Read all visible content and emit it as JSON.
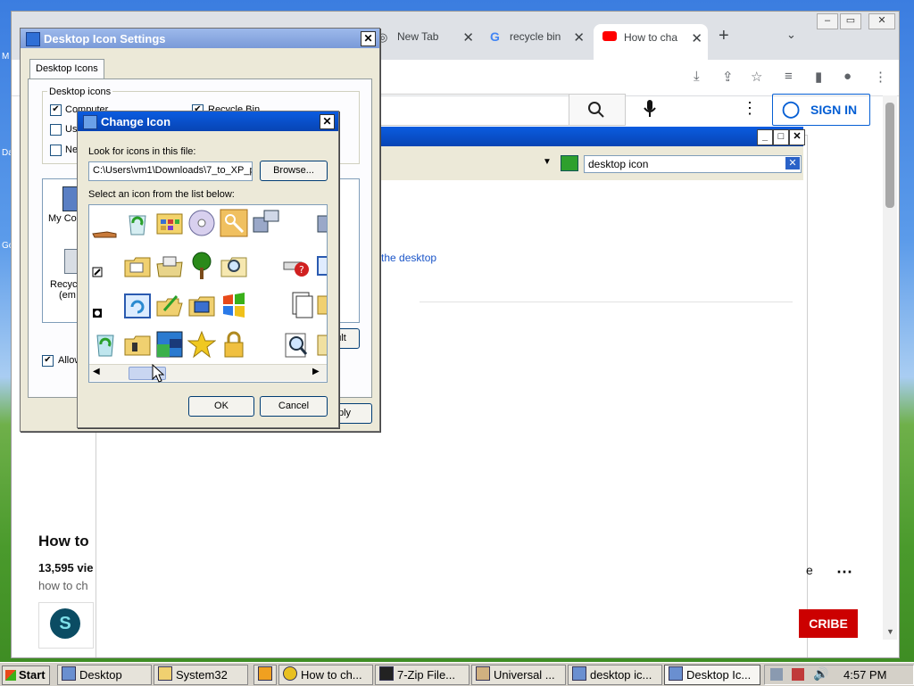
{
  "desktop": {
    "labels": [
      "M",
      "Da",
      "Go"
    ]
  },
  "chrome": {
    "tabs": [
      {
        "label": "New Tab",
        "close": "✕"
      },
      {
        "label": "recycle bin",
        "close": "✕"
      },
      {
        "label": "How to cha",
        "close": "✕"
      }
    ],
    "new_tab": "+",
    "window_controls": [
      "‒",
      "▭",
      "✕"
    ],
    "youtube": {
      "sign_in": "SIGN IN",
      "video_title": "How to",
      "views": "13,595 vie",
      "description": "how to ch",
      "subscribe": "CRIBE",
      "more": "e",
      "channel_letter": "S"
    }
  },
  "zip_window": {
    "search_value": "desktop icon",
    "result_link": "the desktop",
    "default_button": "ault",
    "apply_button": "ply"
  },
  "desktop_icon_settings": {
    "title": "Desktop Icon Settings",
    "tab": "Desktop Icons",
    "group": "Desktop icons",
    "checkboxes": [
      {
        "label": "Computer",
        "checked": true
      },
      {
        "label": "Recycle Bin",
        "checked": true
      },
      {
        "label": "Us",
        "checked": false
      },
      {
        "label": "Ne",
        "checked": false
      }
    ],
    "icons": [
      "My Co",
      "Recyc",
      "(em"
    ],
    "allow_label": "Allow",
    "allow_checked": true
  },
  "change_icon": {
    "title": "Change Icon",
    "look_label": "Look for icons in this file:",
    "path_value": "C:\\Users\\vm1\\Downloads\\7_to_XP_p",
    "browse": "Browse...",
    "select_label": "Select an icon from the list below:",
    "ok": "OK",
    "cancel": "Cancel"
  },
  "taskbar": {
    "start": "Start",
    "items": [
      "Desktop",
      "System32",
      "",
      "How to ch...",
      "7-Zip File...",
      "Universal ...",
      "desktop ic...",
      "Desktop Ic..."
    ],
    "clock": "4:57 PM"
  },
  "colors": {
    "xp_title_active": "#0a5ce0",
    "xp_face": "#ece9d8",
    "youtube_blue": "#065fd4",
    "subscribe_red": "#cc0000"
  }
}
